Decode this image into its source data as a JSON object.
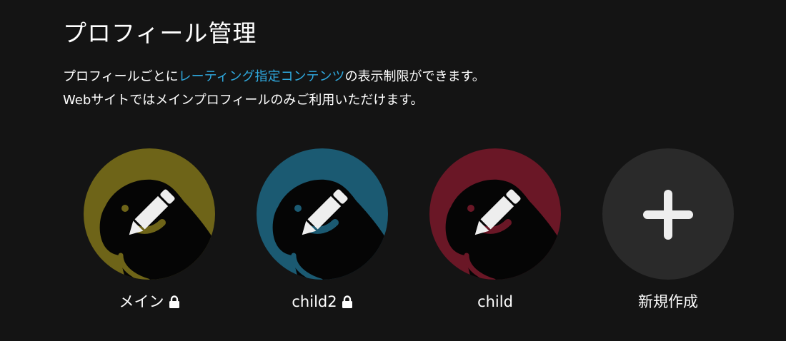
{
  "page": {
    "title": "プロフィール管理"
  },
  "description": {
    "line1_prefix": "プロフィールごとに",
    "line1_link": "レーティング指定コンテンツ",
    "line1_suffix": "の表示制限ができます。",
    "line2": "Webサイトではメインプロフィールのみご利用いただけます。"
  },
  "colors": {
    "background": "#141414",
    "link": "#2fa8dd",
    "profile_main": "#6e6418",
    "profile_child2": "#1b5a72",
    "profile_child": "#6a1726",
    "add_profile": "#2a2a2a"
  },
  "profiles": [
    {
      "name": "メイン",
      "locked": true,
      "icon": "pencil-icon"
    },
    {
      "name": "child2",
      "locked": true,
      "icon": "pencil-icon"
    },
    {
      "name": "child",
      "locked": false,
      "icon": "pencil-icon"
    }
  ],
  "add_profile": {
    "label": "新規作成",
    "icon": "plus-icon"
  }
}
